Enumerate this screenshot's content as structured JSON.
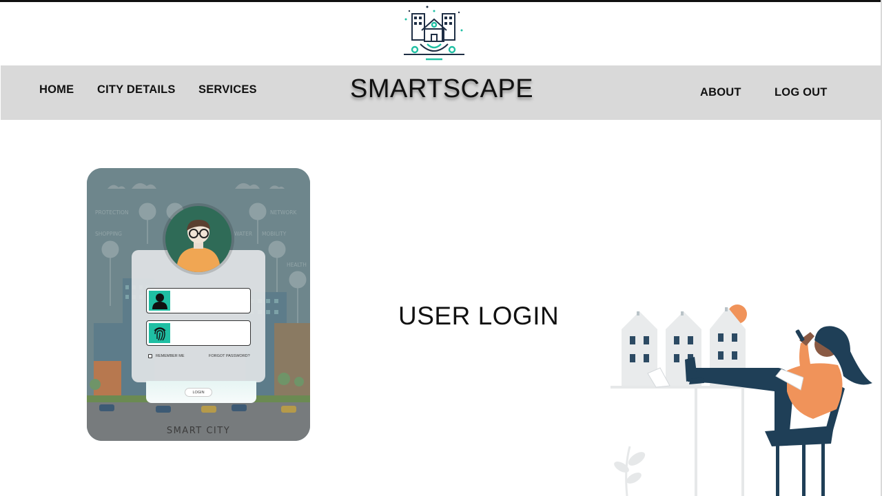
{
  "brand": {
    "logo": "smart-city-house-gear-logo",
    "name": "SMARTSCAPE"
  },
  "nav": {
    "left": [
      {
        "id": "home",
        "label": "HOME"
      },
      {
        "id": "city-details",
        "label": "CITY DETAILS"
      },
      {
        "id": "services",
        "label": "SERVICES"
      }
    ],
    "right": [
      {
        "id": "about",
        "label": "ABOUT"
      },
      {
        "id": "logout",
        "label": "LOG OUT"
      }
    ]
  },
  "login_card": {
    "background_labels": [
      "PROTECTION",
      "NETWORK",
      "SHOPPING",
      "WATER",
      "MOBILITY",
      "HEALTH"
    ],
    "username_icon": "user-icon",
    "password_icon": "fingerprint-icon",
    "remember_label": "REMEMBER ME",
    "forgot_label": "FORGOT PASSWORD?",
    "login_label": "LOGIN",
    "caption": "SMART CITY",
    "accent_color": "#1fbfa3"
  },
  "heading": "USER LOGIN",
  "colors": {
    "navbar": "#d9d9d9",
    "accent": "#1fbfa3",
    "illustration_orange": "#f0935a",
    "illustration_navy": "#1f3f57"
  }
}
